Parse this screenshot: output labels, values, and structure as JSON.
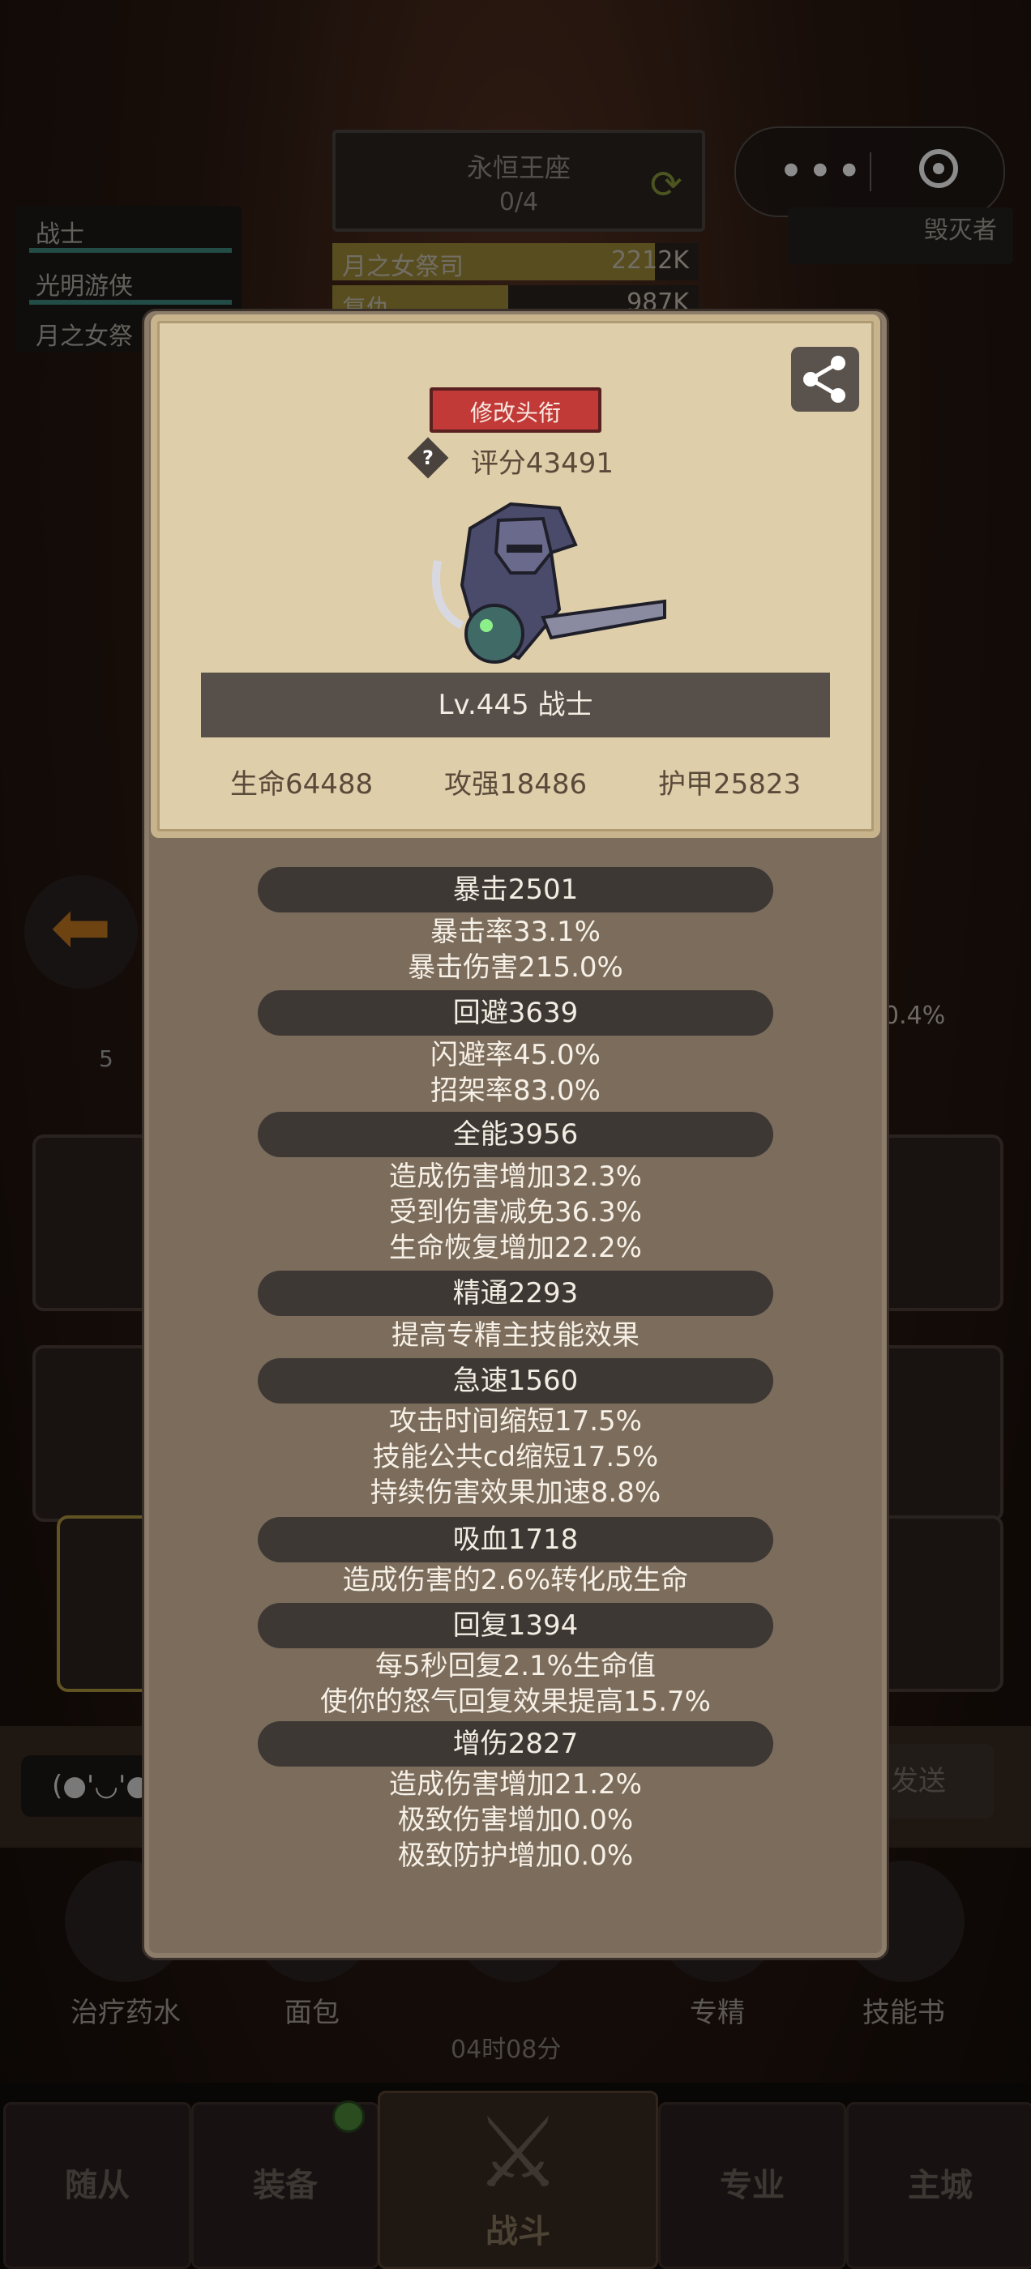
{
  "background": {
    "boss": {
      "name": "永恒王座",
      "progress": "0/4"
    },
    "enemy_name": "毁灭者",
    "party": [
      "战士",
      "光明游侠",
      "月之女祭"
    ],
    "damage_rows": [
      {
        "name": "月之女祭司",
        "value": "2212K",
        "fill": 0.88
      },
      {
        "name": "复仇",
        "value": "987K",
        "fill": 0.48
      }
    ],
    "side_percent": "0.4%",
    "side_level": "5",
    "chat_placeholder": "(●'◡'●",
    "send_label": "发送",
    "items": [
      {
        "label": "治疗药水"
      },
      {
        "label": "面包"
      },
      {
        "label": ""
      },
      {
        "label": "专精"
      },
      {
        "label": "技能书"
      }
    ],
    "timer": "04时08分",
    "nav": {
      "followers": "随从",
      "equipment": "装备",
      "battle": "战斗",
      "profession": "专业",
      "main_city": "主城"
    }
  },
  "modal": {
    "title_button": "修改头衔",
    "score": "评分43491",
    "level_class": "Lv.445 战士",
    "base_stats": {
      "hp": "生命64488",
      "attack": "攻强18486",
      "armor": "护甲25823"
    },
    "stats": [
      {
        "name": "暴击2501",
        "lines": [
          "暴击率33.1%",
          "暴击伤害215.0%"
        ]
      },
      {
        "name": "回避3639",
        "lines": [
          "闪避率45.0%",
          "招架率83.0%"
        ]
      },
      {
        "name": "全能3956",
        "lines": [
          "造成伤害增加32.3%",
          "受到伤害减免36.3%",
          "生命恢复增加22.2%"
        ]
      },
      {
        "name": "精通2293",
        "lines": [
          "提高专精主技能效果"
        ]
      },
      {
        "name": "急速1560",
        "lines": [
          "攻击时间缩短17.5%",
          "技能公共cd缩短17.5%",
          "持续伤害效果加速8.8%"
        ]
      },
      {
        "name": "吸血1718",
        "lines": [
          "造成伤害的2.6%转化成生命"
        ]
      },
      {
        "name": "回复1394",
        "lines": [
          "每5秒回复2.1%生命值",
          "使你的怒气回复效果提高15.7%"
        ]
      },
      {
        "name": "增伤2827",
        "lines": [
          "造成伤害增加21.2%",
          "极致伤害增加0.0%",
          "极致防护增加0.0%"
        ]
      }
    ]
  },
  "colors": {
    "title_button": "#c23a38",
    "card": "#dfceaa",
    "panel": "#7b6c5c",
    "stat_header": "#3d3834"
  }
}
